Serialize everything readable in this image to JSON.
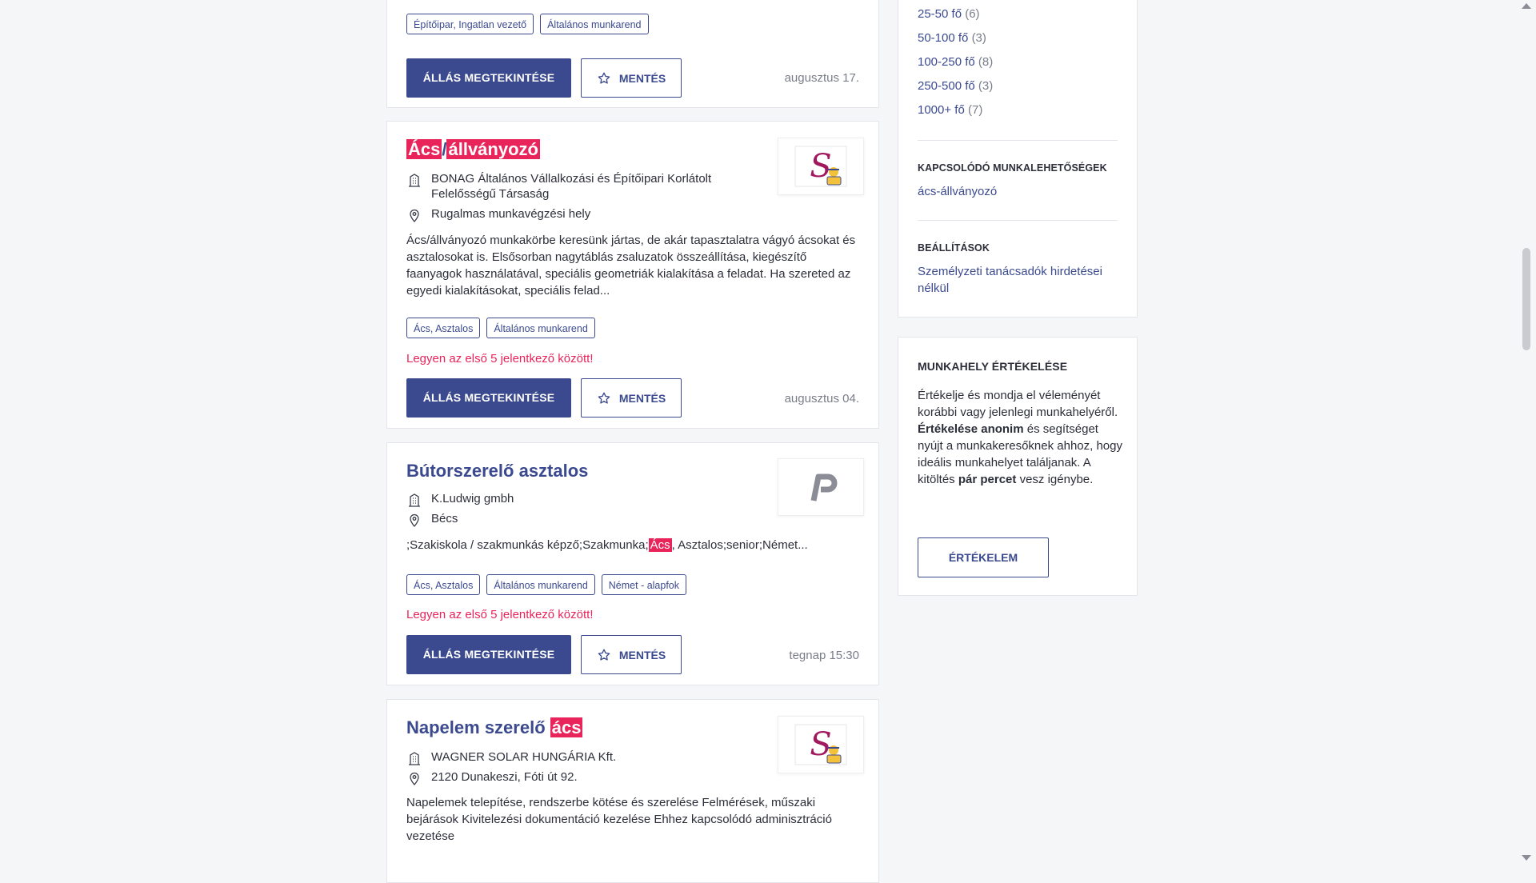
{
  "jobs": [
    {
      "tags": [
        "Építőipar, Ingatlan vezető",
        "Általános munkarend"
      ],
      "view_label": "ÁLLÁS MEGTEKINTÉSE",
      "save_label": "MENTÉS",
      "date": "augusztus 17."
    },
    {
      "title_hl1": "Ács",
      "title_sep": "/",
      "title_hl2": "állványozó",
      "company": "BONAG Általános Vállalkozási és Építőipari Korlátolt Felelősségű Társaság",
      "location": "Rugalmas munkavégzési hely",
      "description": "Ács/állványozó munkakörbe keresünk jártas, de akár tapasztalatra vágyó ácsokat és asztalosokat is. Elsősorban nagytáblás zsaluzatok összeállítása, kiegészítő faanyagok használatával, speciális geometriák kialakítása a feladat. Ha szereted az egyedi kialakításokat, speciális felad...",
      "tags": [
        "Ács, Asztalos",
        "Általános munkarend"
      ],
      "first5": "Legyen az első 5 jelentkező között!",
      "view_label": "ÁLLÁS MEGTEKINTÉSE",
      "save_label": "MENTÉS",
      "date": "augusztus 04."
    },
    {
      "title": "Bútorszerelő asztalos",
      "company": "K.Ludwig gmbh",
      "location": "Bécs",
      "desc_pre": ";Szakiskola / szakmunkás képző;Szakmunka;",
      "desc_hl": "Ács",
      "desc_post": ", Asztalos;senior;Német...",
      "tags": [
        "Ács, Asztalos",
        "Általános munkarend",
        "Német - alapfok"
      ],
      "first5": "Legyen az első 5 jelentkező között!",
      "view_label": "ÁLLÁS MEGTEKINTÉSE",
      "save_label": "MENTÉS",
      "date": "tegnap 15:30"
    },
    {
      "title_pre": "Napelem szerelő ",
      "title_hl": "ács",
      "company": "WAGNER SOLAR HUNGÁRIA Kft.",
      "location": "2120 Dunakeszi, Fóti út 92.",
      "description": "Napelemek telepítése, rendszerbe kötése és szerelése Felmérések, műszaki bejárások Kivitelezési dokumentáció kezelése Ehhez kapcsolódó adminisztráció vezetése"
    }
  ],
  "sidebar": {
    "sizes": [
      {
        "label": "25-50 fő",
        "count": "(6)"
      },
      {
        "label": "50-100 fő",
        "count": "(3)"
      },
      {
        "label": "100-250 fő",
        "count": "(8)"
      },
      {
        "label": "250-500 fő",
        "count": "(3)"
      },
      {
        "label": "1000+ fő",
        "count": "(7)"
      }
    ],
    "related_title": "KAPCSOLÓDÓ MUNKALEHETŐSÉGEK",
    "related_link": "ács-állványozó",
    "settings_title": "BEÁLLÍTÁSOK",
    "settings_link": "Személyzeti tanácsadók hirdetései nélkül",
    "rating_title": "MUNKAHELY ÉRTÉKELÉSE",
    "rating_p1": "Értékelje és mondja el véleményét korábbi vagy jelenlegi munkahelyéről.",
    "rating_b1": "Értékelése anonim",
    "rating_p2": " és segítséget nyújt a munkakeresőknek ahhoz, hogy ideális munkahelyet találjanak. A kitöltés ",
    "rating_b2": "pár percet",
    "rating_p3": " vesz igénybe.",
    "rating_button": "ÉRTÉKELEM"
  },
  "colors": {
    "accent": "#3b4a8f",
    "highlight": "#e8245a"
  }
}
